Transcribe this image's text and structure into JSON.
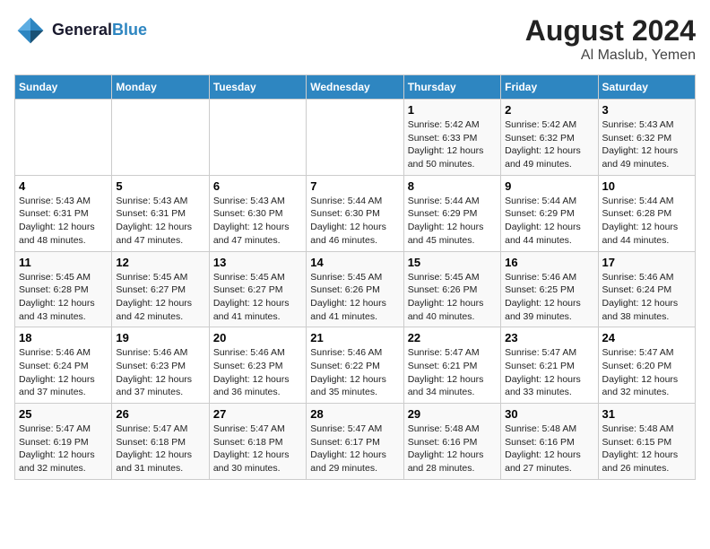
{
  "header": {
    "logo_line1": "General",
    "logo_line2": "Blue",
    "main_title": "August 2024",
    "sub_title": "Al Maslub, Yemen"
  },
  "days_of_week": [
    "Sunday",
    "Monday",
    "Tuesday",
    "Wednesday",
    "Thursday",
    "Friday",
    "Saturday"
  ],
  "weeks": [
    [
      {
        "day": "",
        "info": ""
      },
      {
        "day": "",
        "info": ""
      },
      {
        "day": "",
        "info": ""
      },
      {
        "day": "",
        "info": ""
      },
      {
        "day": "1",
        "info": "Sunrise: 5:42 AM\nSunset: 6:33 PM\nDaylight: 12 hours\nand 50 minutes."
      },
      {
        "day": "2",
        "info": "Sunrise: 5:42 AM\nSunset: 6:32 PM\nDaylight: 12 hours\nand 49 minutes."
      },
      {
        "day": "3",
        "info": "Sunrise: 5:43 AM\nSunset: 6:32 PM\nDaylight: 12 hours\nand 49 minutes."
      }
    ],
    [
      {
        "day": "4",
        "info": "Sunrise: 5:43 AM\nSunset: 6:31 PM\nDaylight: 12 hours\nand 48 minutes."
      },
      {
        "day": "5",
        "info": "Sunrise: 5:43 AM\nSunset: 6:31 PM\nDaylight: 12 hours\nand 47 minutes."
      },
      {
        "day": "6",
        "info": "Sunrise: 5:43 AM\nSunset: 6:30 PM\nDaylight: 12 hours\nand 47 minutes."
      },
      {
        "day": "7",
        "info": "Sunrise: 5:44 AM\nSunset: 6:30 PM\nDaylight: 12 hours\nand 46 minutes."
      },
      {
        "day": "8",
        "info": "Sunrise: 5:44 AM\nSunset: 6:29 PM\nDaylight: 12 hours\nand 45 minutes."
      },
      {
        "day": "9",
        "info": "Sunrise: 5:44 AM\nSunset: 6:29 PM\nDaylight: 12 hours\nand 44 minutes."
      },
      {
        "day": "10",
        "info": "Sunrise: 5:44 AM\nSunset: 6:28 PM\nDaylight: 12 hours\nand 44 minutes."
      }
    ],
    [
      {
        "day": "11",
        "info": "Sunrise: 5:45 AM\nSunset: 6:28 PM\nDaylight: 12 hours\nand 43 minutes."
      },
      {
        "day": "12",
        "info": "Sunrise: 5:45 AM\nSunset: 6:27 PM\nDaylight: 12 hours\nand 42 minutes."
      },
      {
        "day": "13",
        "info": "Sunrise: 5:45 AM\nSunset: 6:27 PM\nDaylight: 12 hours\nand 41 minutes."
      },
      {
        "day": "14",
        "info": "Sunrise: 5:45 AM\nSunset: 6:26 PM\nDaylight: 12 hours\nand 41 minutes."
      },
      {
        "day": "15",
        "info": "Sunrise: 5:45 AM\nSunset: 6:26 PM\nDaylight: 12 hours\nand 40 minutes."
      },
      {
        "day": "16",
        "info": "Sunrise: 5:46 AM\nSunset: 6:25 PM\nDaylight: 12 hours\nand 39 minutes."
      },
      {
        "day": "17",
        "info": "Sunrise: 5:46 AM\nSunset: 6:24 PM\nDaylight: 12 hours\nand 38 minutes."
      }
    ],
    [
      {
        "day": "18",
        "info": "Sunrise: 5:46 AM\nSunset: 6:24 PM\nDaylight: 12 hours\nand 37 minutes."
      },
      {
        "day": "19",
        "info": "Sunrise: 5:46 AM\nSunset: 6:23 PM\nDaylight: 12 hours\nand 37 minutes."
      },
      {
        "day": "20",
        "info": "Sunrise: 5:46 AM\nSunset: 6:23 PM\nDaylight: 12 hours\nand 36 minutes."
      },
      {
        "day": "21",
        "info": "Sunrise: 5:46 AM\nSunset: 6:22 PM\nDaylight: 12 hours\nand 35 minutes."
      },
      {
        "day": "22",
        "info": "Sunrise: 5:47 AM\nSunset: 6:21 PM\nDaylight: 12 hours\nand 34 minutes."
      },
      {
        "day": "23",
        "info": "Sunrise: 5:47 AM\nSunset: 6:21 PM\nDaylight: 12 hours\nand 33 minutes."
      },
      {
        "day": "24",
        "info": "Sunrise: 5:47 AM\nSunset: 6:20 PM\nDaylight: 12 hours\nand 32 minutes."
      }
    ],
    [
      {
        "day": "25",
        "info": "Sunrise: 5:47 AM\nSunset: 6:19 PM\nDaylight: 12 hours\nand 32 minutes."
      },
      {
        "day": "26",
        "info": "Sunrise: 5:47 AM\nSunset: 6:18 PM\nDaylight: 12 hours\nand 31 minutes."
      },
      {
        "day": "27",
        "info": "Sunrise: 5:47 AM\nSunset: 6:18 PM\nDaylight: 12 hours\nand 30 minutes."
      },
      {
        "day": "28",
        "info": "Sunrise: 5:47 AM\nSunset: 6:17 PM\nDaylight: 12 hours\nand 29 minutes."
      },
      {
        "day": "29",
        "info": "Sunrise: 5:48 AM\nSunset: 6:16 PM\nDaylight: 12 hours\nand 28 minutes."
      },
      {
        "day": "30",
        "info": "Sunrise: 5:48 AM\nSunset: 6:16 PM\nDaylight: 12 hours\nand 27 minutes."
      },
      {
        "day": "31",
        "info": "Sunrise: 5:48 AM\nSunset: 6:15 PM\nDaylight: 12 hours\nand 26 minutes."
      }
    ]
  ]
}
